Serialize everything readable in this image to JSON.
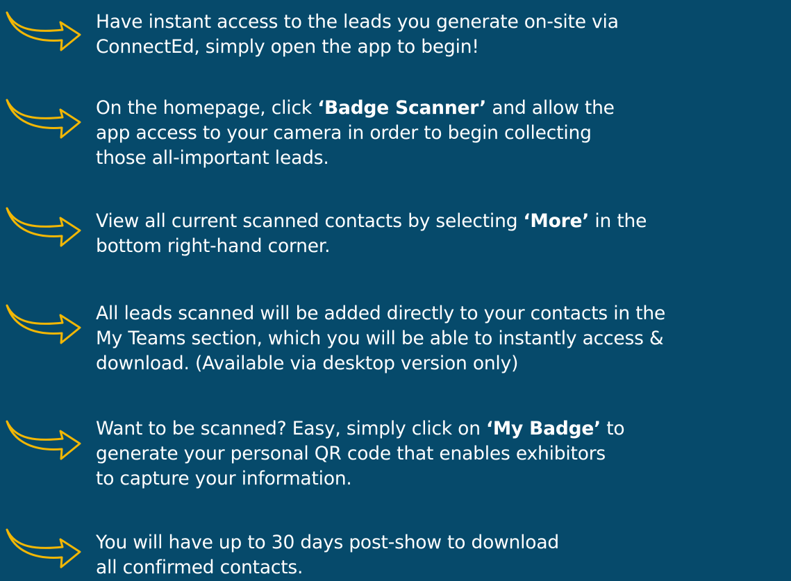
{
  "accent_color": "#f2b705",
  "background_color": "#064a6b",
  "arrow_icon": "curved-arrow-icon",
  "steps": [
    {
      "lines": [
        [
          {
            "t": "Have instant access to the leads you generate on-site via"
          }
        ],
        [
          {
            "t": "ConnectEd, simply open the app to begin!"
          }
        ]
      ]
    },
    {
      "lines": [
        [
          {
            "t": "On the homepage, click "
          },
          {
            "t": "‘Badge Scanner’",
            "b": true
          },
          {
            "t": " and allow the"
          }
        ],
        [
          {
            "t": "app access to your camera in order to begin collecting"
          }
        ],
        [
          {
            "t": "those all-important leads."
          }
        ]
      ]
    },
    {
      "lines": [
        [
          {
            "t": "View all current scanned contacts by selecting "
          },
          {
            "t": "‘More’",
            "b": true
          },
          {
            "t": " in the"
          }
        ],
        [
          {
            "t": "bottom right-hand corner."
          }
        ]
      ]
    },
    {
      "lines": [
        [
          {
            "t": "All leads scanned will be added directly to your contacts in the"
          }
        ],
        [
          {
            "t": "My Teams section, which you will be able to instantly access &"
          }
        ],
        [
          {
            "t": "download. (Available via desktop version only)"
          }
        ]
      ]
    },
    {
      "lines": [
        [
          {
            "t": "Want to be scanned? Easy, simply click on "
          },
          {
            "t": "‘My Badge’",
            "b": true
          },
          {
            "t": " to"
          }
        ],
        [
          {
            "t": "generate your personal QR code that enables exhibitors"
          }
        ],
        [
          {
            "t": "to capture your information."
          }
        ]
      ]
    },
    {
      "lines": [
        [
          {
            "t": "You will have up to 30 days post-show to download"
          }
        ],
        [
          {
            "t": "all confirmed contacts."
          }
        ]
      ]
    }
  ]
}
